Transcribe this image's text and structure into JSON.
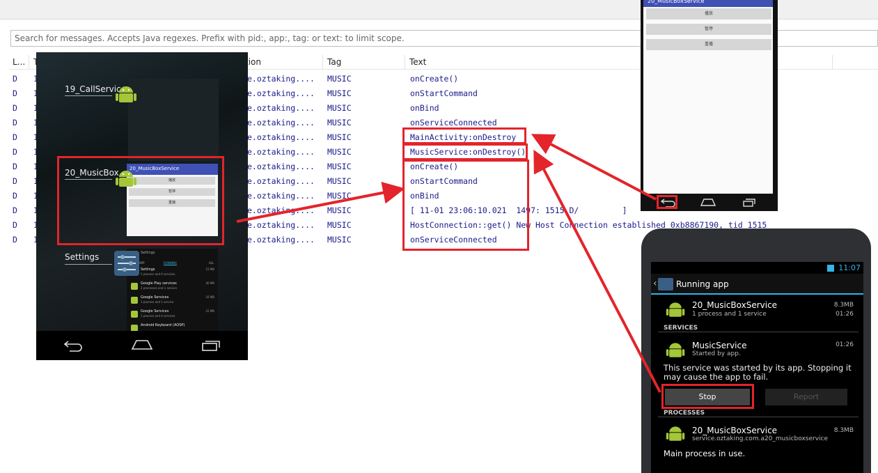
{
  "search": {
    "placeholder": "Search for messages. Accepts Java regexes. Prefix with pid:, app:, tag: or text: to limit scope."
  },
  "table": {
    "headers": [
      "L...",
      "T",
      "tion",
      "Tag",
      "Text"
    ],
    "rows": [
      {
        "level": "D",
        "tid": "1",
        "app": "e.oztaking....",
        "tag": "MUSIC",
        "text": "onCreate()"
      },
      {
        "level": "D",
        "tid": "1",
        "app": "e.oztaking....",
        "tag": "MUSIC",
        "text": "onStartCommand"
      },
      {
        "level": "D",
        "tid": "1",
        "app": "e.oztaking....",
        "tag": "MUSIC",
        "text": "onBind"
      },
      {
        "level": "D",
        "tid": "1",
        "app": "e.oztaking....",
        "tag": "MUSIC",
        "text": "onServiceConnected"
      },
      {
        "level": "D",
        "tid": "1",
        "app": "e.oztaking....",
        "tag": "MUSIC",
        "text": "MainActivity:onDestroy"
      },
      {
        "level": "D",
        "tid": "1",
        "app": "e.oztaking....",
        "tag": "MUSIC",
        "text": "MusicService:onDestroy()"
      },
      {
        "level": "D",
        "tid": "1",
        "app": "e.oztaking....",
        "tag": "MUSIC",
        "text": "onCreate()"
      },
      {
        "level": "D",
        "tid": "1",
        "app": "e.oztaking....",
        "tag": "MUSIC",
        "text": "onStartCommand"
      },
      {
        "level": "D",
        "tid": "1",
        "app": "e.oztaking....",
        "tag": "MUSIC",
        "text": "onBind"
      },
      {
        "level": "D",
        "tid": "1",
        "app": "e.oztaking....",
        "tag": "MUSIC",
        "text": "[ 11-01 23:06:10.021  1497: 1515 D/         ]"
      },
      {
        "level": "D",
        "tid": "1",
        "app": "e.oztaking....",
        "tag": "MUSIC",
        "text": "HostConnection::get() New Host Connection established 0xb8867190, tid 1515"
      },
      {
        "level": "D",
        "tid": "1",
        "app": "e.oztaking....",
        "tag": "MUSIC",
        "text": "onServiceConnected"
      }
    ]
  },
  "recents": {
    "items": [
      "19_CallService",
      "20_MusicBox",
      "Settings"
    ],
    "mini_app_title": "20_MusicBoxService",
    "mini_buttons": [
      "播放",
      "暂停",
      "重播"
    ],
    "settings_thumb": {
      "tabs": [
        "APP",
        "RUNNING",
        "ALL"
      ],
      "rows": [
        {
          "name": "Settings",
          "sub": "1 process and 0 services",
          "size": "23 MB"
        },
        {
          "name": "Google Play services",
          "sub": "2 processes and 1 service",
          "size": "40 MB"
        },
        {
          "name": "Google Services",
          "sub": "1 process and 1 service",
          "size": "16 MB"
        },
        {
          "name": "Google Services",
          "sub": "1 process and 4 services",
          "size": "22 MB"
        },
        {
          "name": "Android Keyboard (AOSP)",
          "sub": "",
          "size": ""
        }
      ]
    }
  },
  "phone_top": {
    "title": "20_MusicBoxService",
    "buttons": [
      "播放",
      "暂停",
      "重播"
    ]
  },
  "running_app": {
    "clock": "11:07",
    "title": "Running app",
    "app_name": "20_MusicBoxService",
    "app_sub": "1 process and 1 service",
    "app_size": "8.3MB",
    "app_time": "01:26",
    "services_header": "SERVICES",
    "service_name": "MusicService",
    "service_sub": "Started by app.",
    "service_time": "01:26",
    "warning": "This service was started by its app. Stopping it may cause the app to fail.",
    "stop_label": "Stop",
    "report_label": "Report",
    "processes_header": "PROCESSES",
    "process_name": "20_MusicBoxService",
    "process_pkg": "service.oztaking.com.a20_musicboxservice",
    "process_size": "8.3MB",
    "process_note": "Main process in use."
  },
  "colors": {
    "accent": "#e3242b",
    "android_green": "#a4c639",
    "holo_blue": "#33b5e5",
    "app_bar": "#3f51b5"
  }
}
